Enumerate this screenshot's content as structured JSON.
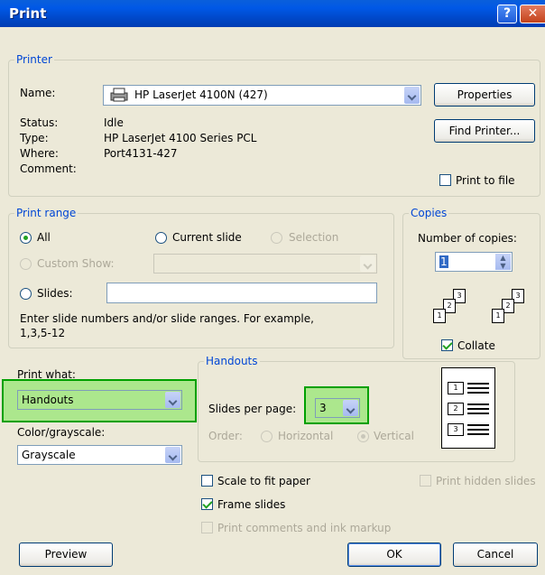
{
  "window": {
    "title": "Print"
  },
  "printer": {
    "group_label": "Printer",
    "name_label": "Name:",
    "name_value": "HP LaserJet 4100N (427)",
    "status_label": "Status:",
    "status_value": "Idle",
    "type_label": "Type:",
    "type_value": "HP LaserJet 4100 Series PCL",
    "where_label": "Where:",
    "where_value": "Port4131-427",
    "comment_label": "Comment:",
    "properties_button": "Properties",
    "find_button": "Find Printer...",
    "print_to_file": "Print to file"
  },
  "print_range": {
    "group_label": "Print range",
    "all": "All",
    "current_slide": "Current slide",
    "selection": "Selection",
    "custom_show": "Custom Show:",
    "slides": "Slides:",
    "hint": "Enter slide numbers and/or slide ranges. For example,",
    "hint_example": "1,3,5-12"
  },
  "copies": {
    "group_label": "Copies",
    "number_label": "Number of copies:",
    "value": "1",
    "collate": "Collate",
    "page_nums": [
      "1",
      "2",
      "3"
    ]
  },
  "print_what": {
    "label": "Print what:",
    "value": "Handouts"
  },
  "color": {
    "label": "Color/grayscale:",
    "value": "Grayscale"
  },
  "handouts": {
    "group_label": "Handouts",
    "slides_per_page_label": "Slides per page:",
    "slides_per_page_value": "3",
    "order_label": "Order:",
    "horizontal": "Horizontal",
    "vertical": "Vertical",
    "preview_nums": [
      "1",
      "2",
      "3"
    ]
  },
  "options": {
    "scale_to_fit": "Scale to fit paper",
    "frame_slides": "Frame slides",
    "print_comments": "Print comments and ink markup",
    "print_hidden": "Print hidden slides"
  },
  "buttons": {
    "preview": "Preview",
    "ok": "OK",
    "cancel": "Cancel"
  },
  "colors": {
    "title_blue": "#0058E6",
    "group_label": "#0046D5",
    "highlight": "#78E650"
  }
}
